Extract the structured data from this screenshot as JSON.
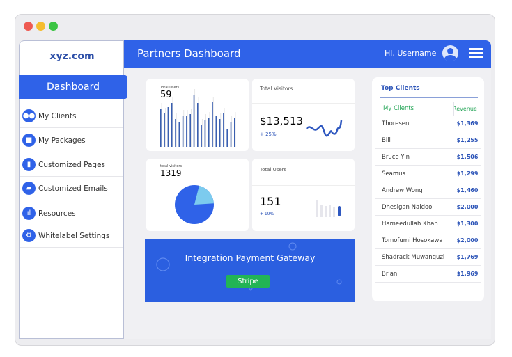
{
  "window": {
    "controls": [
      {
        "name": "close",
        "color": "#ee5a52"
      },
      {
        "name": "minimize",
        "color": "#f5bd2f"
      },
      {
        "name": "maximize",
        "color": "#3cc444"
      }
    ]
  },
  "sidebar": {
    "logo": "xyz.com",
    "active": "Dashboard",
    "items": [
      {
        "label": "My Clients",
        "icon": "users-icon"
      },
      {
        "label": "My Packages",
        "icon": "package-icon"
      },
      {
        "label": "Customized Pages",
        "icon": "page-icon"
      },
      {
        "label": "Customized Emails",
        "icon": "email-icon"
      },
      {
        "label": "Resources",
        "icon": "chart-icon"
      },
      {
        "label": "Whitelabel Settings",
        "icon": "gear-icon"
      }
    ]
  },
  "header": {
    "title": "Partners Dashboard",
    "greeting": "Hi, Username"
  },
  "cards": {
    "c1": {
      "label": "Total Users",
      "value": "59",
      "bars": [
        55,
        48,
        57,
        63,
        40,
        36,
        45,
        45,
        47,
        75,
        63,
        32,
        39,
        42,
        64,
        44,
        40,
        48,
        25,
        36,
        42
      ]
    },
    "c2": {
      "label": "Total Visitors",
      "value": "$13,513",
      "change": "+ 25%"
    },
    "c3": {
      "label": "total visitors",
      "value": "1319",
      "pie_fraction": 0.2
    },
    "c4": {
      "label": "Total Users",
      "value": "151",
      "change": "+ 19%"
    }
  },
  "banner": {
    "title": "Integration Payment  Gateway",
    "button": "Stripe"
  },
  "colors": {
    "primary": "#2f62e8",
    "accent_green": "#22b455"
  },
  "top_clients": {
    "title": "Top Clients",
    "col_name": "My Clients",
    "col_revenue": "Revenue",
    "rows": [
      {
        "name": "Thoresen",
        "revenue": "$1,369"
      },
      {
        "name": "Bill",
        "revenue": "$1,255"
      },
      {
        "name": "Bruce Yin",
        "revenue": "$1,506"
      },
      {
        "name": "Seamus",
        "revenue": "$1,299"
      },
      {
        "name": "Andrew Wong",
        "revenue": "$1,460"
      },
      {
        "name": "Dhesigan Naidoo",
        "revenue": "$2,000"
      },
      {
        "name": "Hameedullah Khan",
        "revenue": "$1,300"
      },
      {
        "name": "Tomofumi Hosokawa",
        "revenue": "$2,000"
      },
      {
        "name": "Shadrack Muwanguzi",
        "revenue": "$1,769"
      },
      {
        "name": "Brian",
        "revenue": "$1,969"
      }
    ]
  }
}
